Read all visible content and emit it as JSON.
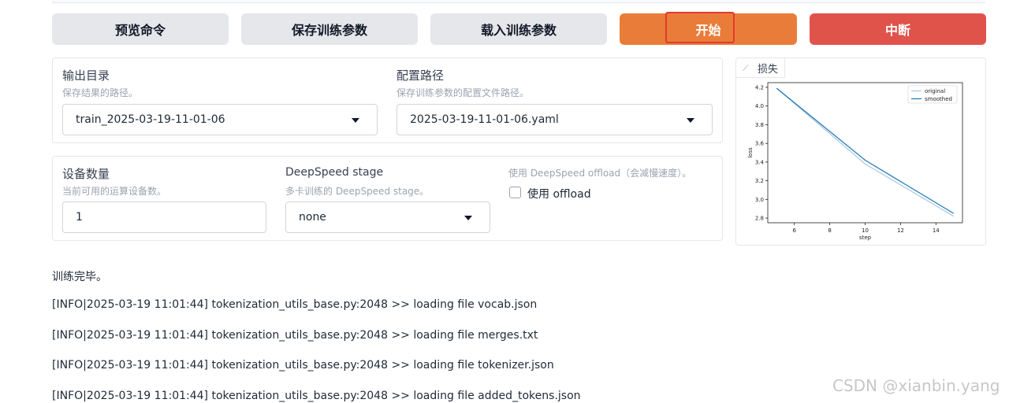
{
  "toolbar": {
    "preview_label": "预览命令",
    "save_label": "保存训练参数",
    "load_label": "载入训练参数",
    "start_label": "开始",
    "abort_label": "中断"
  },
  "output": {
    "dir_label": "输出目录",
    "dir_info": "保存结果的路径。",
    "dir_value": "train_2025-03-19-11-01-06",
    "config_label": "配置路径",
    "config_info": "保存训练参数的配置文件路径。",
    "config_value": "2025-03-19-11-01-06.yaml"
  },
  "device": {
    "count_label": "设备数量",
    "count_info": "当前可用的运算设备数。",
    "count_value": "1",
    "ds_stage_label": "DeepSpeed stage",
    "ds_stage_info": "多卡训练的 DeepSpeed stage。",
    "ds_stage_value": "none",
    "offload_info": "使用 DeepSpeed offload（会减慢速度）。",
    "offload_label": "使用 offload",
    "offload_checked": false
  },
  "chart_tab_label": "损失",
  "chart_data": {
    "type": "line",
    "title": "",
    "xlabel": "step",
    "ylabel": "loss",
    "xlim": [
      4.5,
      15.5
    ],
    "ylim": [
      2.75,
      4.25
    ],
    "xticks": [
      "6",
      "8",
      "10",
      "12",
      "14"
    ],
    "yticks": [
      "2.8",
      "3.0",
      "3.2",
      "3.4",
      "3.6",
      "3.8",
      "4.0",
      "4.2"
    ],
    "legend_position": "top-right",
    "series": [
      {
        "name": "original",
        "color": "#a9c8e0",
        "x": [
          5,
          10,
          15
        ],
        "y": [
          4.19,
          3.38,
          2.82
        ]
      },
      {
        "name": "smoothed",
        "color": "#1f77b4",
        "x": [
          5,
          10,
          15
        ],
        "y": [
          4.19,
          3.42,
          2.85
        ]
      }
    ]
  },
  "log": {
    "status": "训练完毕。",
    "lines": [
      "[INFO|2025-03-19 11:01:44] tokenization_utils_base.py:2048 >> loading file vocab.json",
      "[INFO|2025-03-19 11:01:44] tokenization_utils_base.py:2048 >> loading file merges.txt",
      "[INFO|2025-03-19 11:01:44] tokenization_utils_base.py:2048 >> loading file tokenizer.json",
      "[INFO|2025-03-19 11:01:44] tokenization_utils_base.py:2048 >> loading file added_tokens.json"
    ]
  },
  "watermark": "CSDN @xianbin.yang",
  "colors": {
    "start": "#ea7c3a",
    "abort": "#e0534b",
    "highlight": "#e03b2b"
  }
}
